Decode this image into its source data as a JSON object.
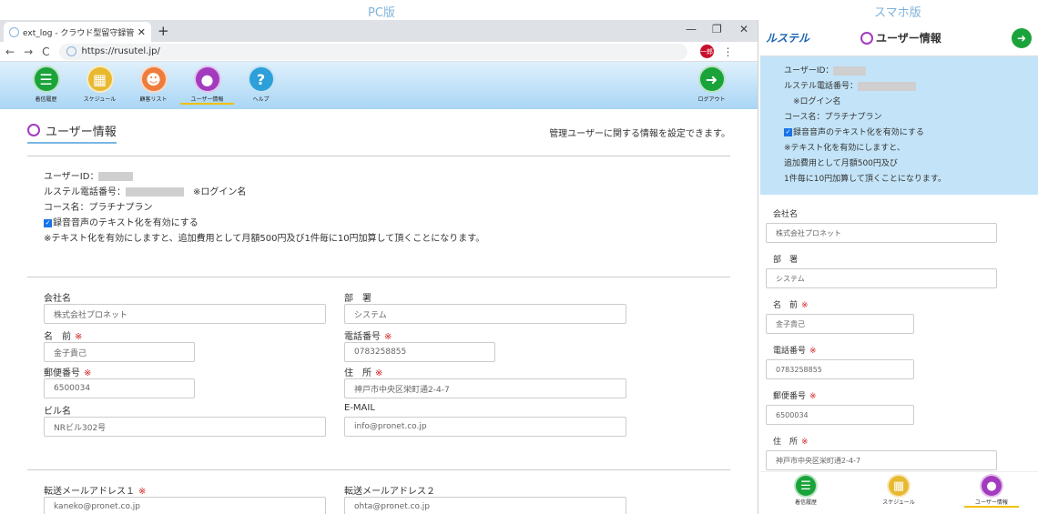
{
  "captions": {
    "pc": "PC版",
    "sp": "スマホ版"
  },
  "browser": {
    "tab_title": "ext_log - クラウド型留守録管理サー",
    "url": "https://rusutel.jp/",
    "profile": "一郎"
  },
  "toolbar": {
    "items": [
      {
        "label": "着信履歴",
        "icon": "list-icon"
      },
      {
        "label": "スケジュール",
        "icon": "calendar-icon"
      },
      {
        "label": "顧客リスト",
        "icon": "people-icon"
      },
      {
        "label": "ユーザー情報",
        "icon": "user-icon"
      },
      {
        "label": "ヘルプ",
        "icon": "help-icon"
      }
    ],
    "logout": "ログアウト"
  },
  "page": {
    "title": "ユーザー情報",
    "description": "管理ユーザーに関する情報を設定できます。"
  },
  "info": {
    "user_id_label": "ユーザーID：",
    "phone_label": "ルステル電話番号：",
    "login_note": "※ログイン名",
    "course": "コース名：プラチナプラン",
    "text_option": "録音音声のテキスト化を有効にする",
    "text_note": "※テキスト化を有効にしますと、追加費用として月額500円及び1件毎に10円加算して頂くことになります。"
  },
  "form": {
    "company_label": "会社名",
    "company_placeholder": "株式会社プロネット",
    "dept_label": "部　署",
    "dept_placeholder": "システム",
    "name_label": "名　前",
    "name_value": "金子貴己",
    "tel_label": "電話番号",
    "tel_value": "0783258855",
    "zip_label": "郵便番号",
    "zip_value": "6500034",
    "addr_label": "住　所",
    "addr_value": "神戸市中央区栄町通2-4-7",
    "bldg_label": "ビル名",
    "bldg_value": "NRビル302号",
    "email_label": "E-MAIL",
    "email_value": "info@pronet.co.jp",
    "req_mark": "※"
  },
  "mail": {
    "fwd1_label": "転送メールアドレス１",
    "fwd1_value": "kaneko@pronet.co.jp",
    "fwd2_label": "転送メールアドレス２",
    "fwd2_value": "ohta@pronet.co.jp"
  },
  "sp": {
    "logo": "ルステル",
    "title": "ユーザー情報",
    "info": {
      "user_id_label": "ユーザーID：",
      "phone_label": "ルステル電話番号：",
      "login_note": "※ログイン名",
      "course": "コース名：プラチナプラン",
      "text_option": "録音音声のテキスト化を有効にする",
      "note1": "※テキスト化を有効にしますと、",
      "note2": "追加費用として月額500円及び",
      "note3": "1件毎に10円加算して頂くことになります。"
    },
    "nav": [
      "着信履歴",
      "スケジュール",
      "ユーザー情報"
    ]
  }
}
